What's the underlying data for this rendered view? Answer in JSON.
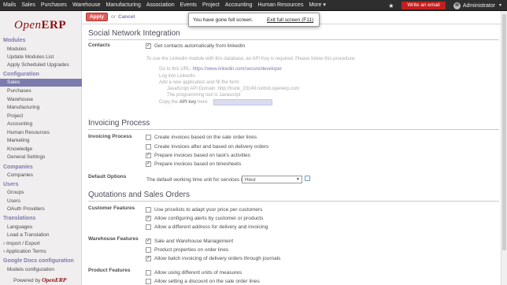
{
  "topbar": {
    "menu": [
      "Mails",
      "Sales",
      "Purchases",
      "Warehouse",
      "Manufacturing",
      "Association",
      "Events",
      "Project",
      "Accounting",
      "Human Resources",
      "More ▾"
    ],
    "write_email": "Write an email",
    "user": "Administrator",
    "star": "★"
  },
  "logo": {
    "open": "Open",
    "erp": "ERP"
  },
  "sidebar": {
    "modules_h": "Modules",
    "modules": [
      "Modules",
      "Update Modules List",
      "Apply Scheduled Upgrades"
    ],
    "config_h": "Configuration",
    "sales": "Sales",
    "config": [
      "Purchases",
      "Warehouse",
      "Manufacturing",
      "Project",
      "Accounting",
      "Human Resources",
      "Marketing",
      "Knowledge",
      "General Settings"
    ],
    "companies_h": "Companies",
    "companies": "Companies",
    "users_h": "Users",
    "users": [
      "Groups",
      "Users",
      "OAuth Providers"
    ],
    "trans_h": "Translations",
    "trans": [
      "Languages",
      "Load a Translation"
    ],
    "import": "› Import / Export",
    "app_terms": "› Application Terms",
    "gdocs_h": "Google Docs configuration",
    "models": "Models configuration",
    "powered": "Powered by ",
    "powered_brand": "OpenERP"
  },
  "toolbar": {
    "apply": "Apply",
    "or": "or",
    "cancel": "Cancel"
  },
  "notice": {
    "text": "You have gone full screen.",
    "exit": "Exit full screen (F11)"
  },
  "social": {
    "title": "Social Network Integration",
    "contacts_label": "Contacts",
    "contacts_opt": "Get contacts automatically from linkedIn",
    "hint_intro": "To use the LinkedIn module with this database, an API Key is required. Please follow this procedure:",
    "hint_1": "Go to this URL:",
    "hint_url": "https://www.linkedin.com/secure/developer",
    "hint_2": "Log into LinkedIn.",
    "hint_3": "Add a new application and fill the form:",
    "hint_4": "JavaScript API Domain: http://trunk_23149.runbot.openerp.com",
    "hint_5": "The programming tool is Javascript",
    "hint_6": "Copy the",
    "hint_api": "API key",
    "hint_6b": "here:"
  },
  "invoicing": {
    "title": "Invoicing Process",
    "label": "Invoicing Process",
    "options": [
      "Create invoices based on the sale order lines",
      "Create invoices after and based on delivery orders",
      "Prepare invoices based on task's activities",
      "Prepare invoices based on timesheets"
    ],
    "checked": [
      false,
      false,
      true,
      true
    ],
    "default_label": "Default Options",
    "services_label": "The default working time unit for services is",
    "services_value": "Hour"
  },
  "quotations": {
    "title": "Quotations and Sales Orders",
    "customer_label": "Customer Features",
    "customer": [
      "Use pricelists to adapt your price per customers",
      "Allow configuring alerts by customer or products",
      "Allow a different address for delivery and invoicing"
    ],
    "customer_checked": [
      false,
      true,
      false
    ],
    "warehouse_label": "Warehouse Features",
    "warehouse": [
      "Sale and Warehouse Management",
      "Product properties on order lines",
      "Allow batch invoicing of delivery orders through journals"
    ],
    "warehouse_checked": [
      true,
      false,
      true
    ],
    "product_label": "Product Features",
    "product": [
      "Allow using different units of measures",
      "Allow setting a discount on the sale order lines"
    ],
    "product_checked": [
      false,
      false
    ]
  }
}
